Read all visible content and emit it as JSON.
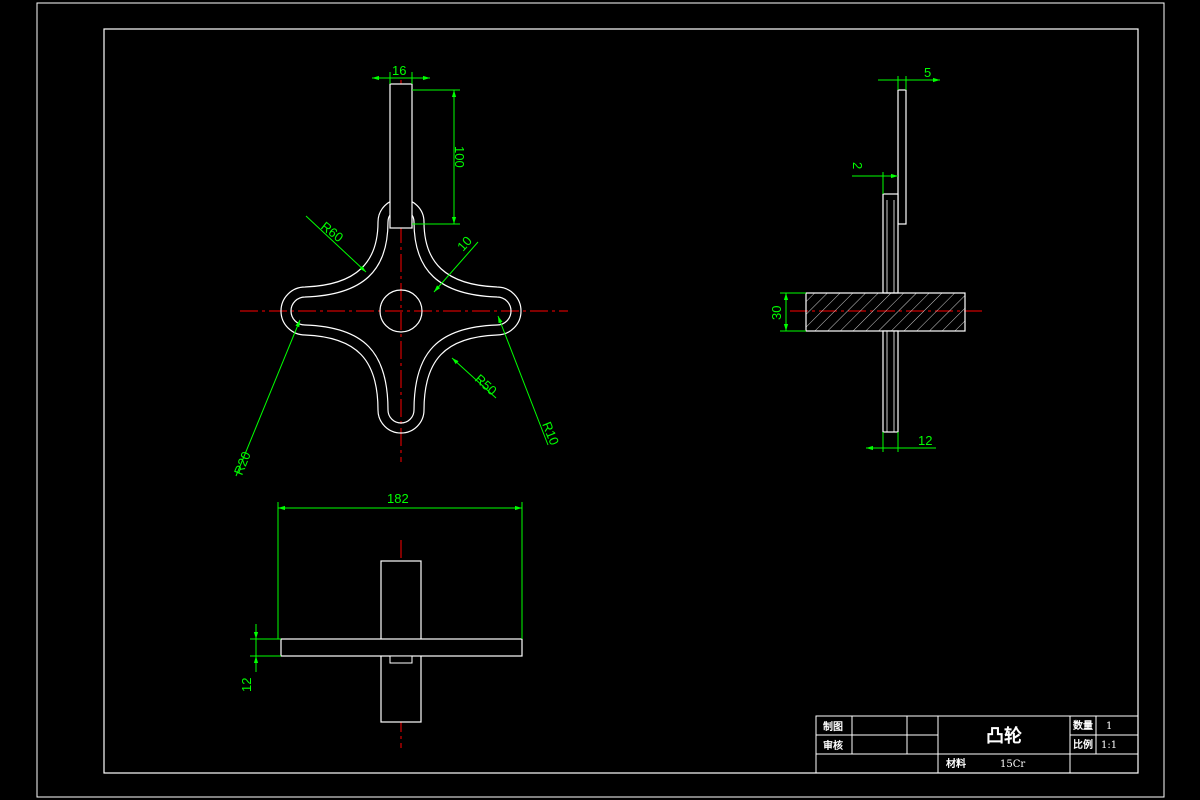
{
  "colors": {
    "background": "#000000",
    "outline": "#ffffff",
    "dimension": "#00ff00",
    "centerline": "#ff0000"
  },
  "dimensions": {
    "top_width": "16",
    "arm_length": "100",
    "corner_radius": "R60",
    "wall": "10",
    "inner_radius": "R50",
    "outer_radius": "R10",
    "lobe_radius": "R20",
    "side_top_width": "5",
    "side_step": "2",
    "side_hub_height": "30",
    "side_bottom_width": "12",
    "front_width": "182",
    "front_thickness": "12"
  },
  "title_block": {
    "drawn_label": "制图",
    "checked_label": "审核",
    "part_name": "凸轮",
    "quantity_label": "数量",
    "quantity_value": "1",
    "scale_label": "比例",
    "scale_value": "1:1",
    "material_label": "材料",
    "material_value": "15Cr"
  }
}
